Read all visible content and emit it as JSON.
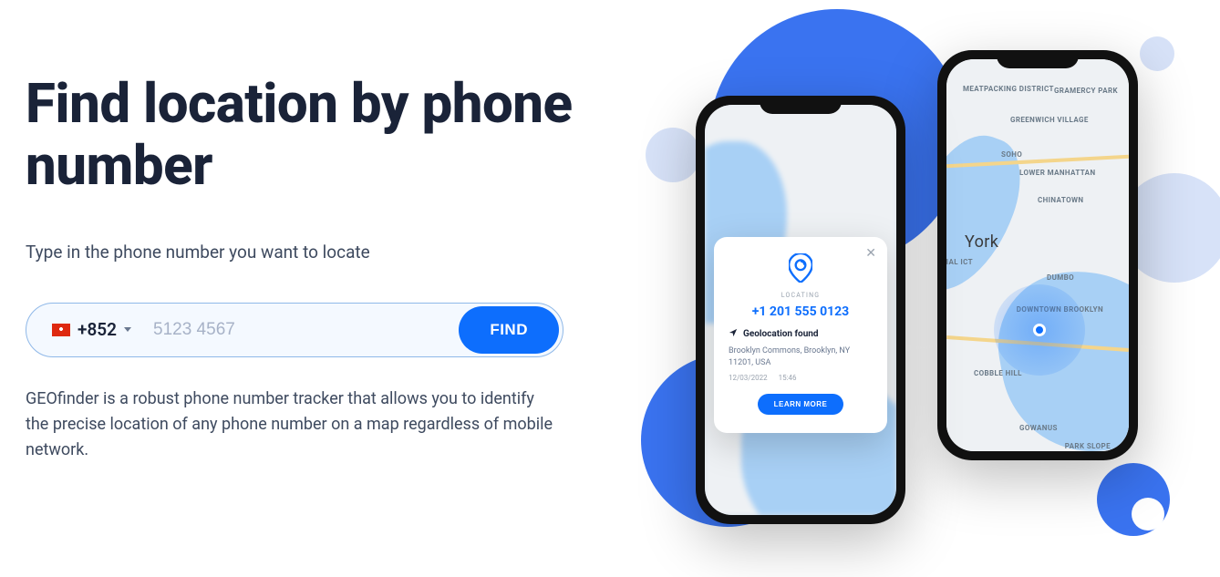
{
  "hero": {
    "title": "Find location by phone number",
    "subtitle": "Type in the phone number you want to locate",
    "description": "GEOfinder is a robust phone number tracker that allows you to identify the precise location of any phone number on a map regardless of mobile network."
  },
  "phone_input": {
    "country_flag": "hk",
    "dial_code": "+852",
    "placeholder": "5123 4567",
    "value": "",
    "find_label": "FIND"
  },
  "mockup": {
    "back_labels": {
      "meatpacking": "MEATPACKING DISTRICT",
      "gramercy": "GRAMERCY PARK",
      "greenwich": "GREENWICH VILLAGE",
      "soho": "SOHO",
      "lower_manhattan": "LOWER MANHATTAN",
      "chinatown": "CHINATOWN",
      "york": "York",
      "dumbo": "DUMBO",
      "downtown_brooklyn": "DOWNTOWN BROOKLYN",
      "cobble_hill": "COBBLE HILL",
      "gowanus": "GOWANUS",
      "park_slope": "PARK SLOPE",
      "cial_ict": "CIAL ICT"
    },
    "card": {
      "locating_label": "LOCATING",
      "phone": "+1 201 555 0123",
      "found_label": "Geolocation found",
      "address": "Brooklyn Commons, Brooklyn, NY 11201, USA",
      "date": "12/03/2022",
      "time": "15:46",
      "learn_more": "LEARN MORE"
    }
  },
  "colors": {
    "primary": "#0d6efd",
    "text_dark": "#1a2338",
    "text_muted": "#3e4a5f"
  }
}
